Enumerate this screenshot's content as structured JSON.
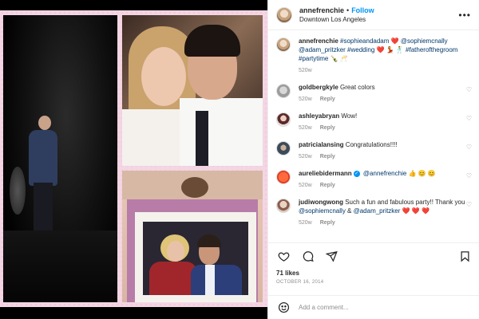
{
  "post": {
    "username": "annefrenchie",
    "follow_label": "Follow",
    "separator": "•",
    "location": "Downtown Los Angeles",
    "more_icon": "more-horizontal-icon"
  },
  "caption": {
    "username": "annefrenchie",
    "text_a": "#sophieandadam ❤️ ",
    "tag_sophie": "@sophiemcnally",
    "text_b": " ",
    "tag_adam": "@adam_pritzker",
    "text_c": " #wedding ❤️ 💃 🕺 #fatherofthegroom #partytime 🍾 🥂",
    "time": "520w"
  },
  "comments": [
    {
      "username": "goldbergkyle",
      "text": "Great colors",
      "time": "520w",
      "reply": "Reply"
    },
    {
      "username": "ashleyabryan",
      "text": "Wow!",
      "time": "520w",
      "reply": "Reply"
    },
    {
      "username": "patricialansing",
      "text": "Congratulations!!!!",
      "time": "520w",
      "reply": "Reply"
    },
    {
      "username": "aureliebidermann",
      "tag": "@annefrenchie",
      "text": " 👍 😊 😊",
      "time": "520w",
      "reply": "Reply",
      "verified": true
    },
    {
      "username": "judiwongwong",
      "text_a": "Such a fun and fabulous party!! Thank you ",
      "tag_a": "@sophiemcnally",
      "text_b": " & ",
      "tag_b": "@adam_pritzker",
      "text_c": " ❤️ ❤️ ❤️",
      "time": "520w",
      "reply": "Reply"
    }
  ],
  "actions": {
    "like_icon": "heart-icon",
    "comment_icon": "comment-bubble-icon",
    "share_icon": "paper-plane-icon",
    "save_icon": "bookmark-icon",
    "likes_text": "71 likes",
    "date_text": "OCTOBER 16, 2014"
  },
  "add_comment": {
    "emoji_icon": "emoji-smile-icon",
    "placeholder": "Add a comment..."
  },
  "colors": {
    "link": "#00376b",
    "follow": "#0095f6",
    "muted": "#8e8e8e",
    "collage_border": "#f2d6e3"
  }
}
